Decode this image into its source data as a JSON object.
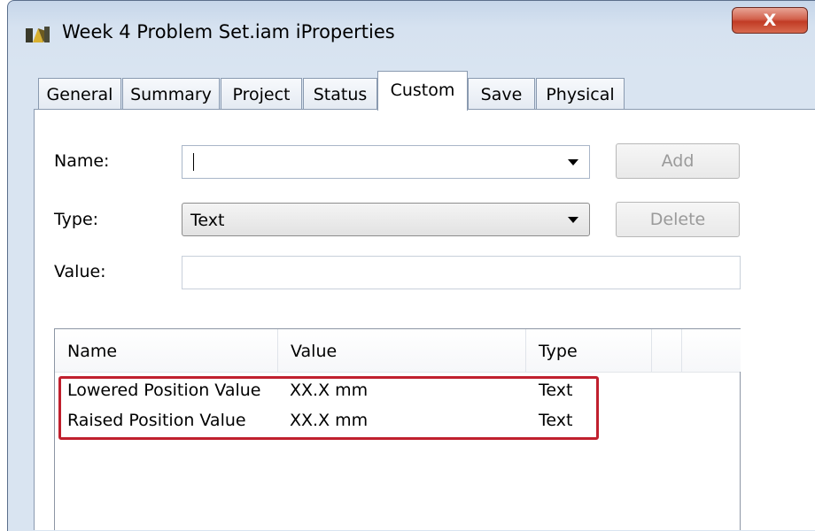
{
  "window": {
    "title": "Week 4 Problem Set.iam iProperties",
    "close_label": "X"
  },
  "tabs": [
    {
      "label": "General"
    },
    {
      "label": "Summary"
    },
    {
      "label": "Project"
    },
    {
      "label": "Status"
    },
    {
      "label": "Custom",
      "active": true
    },
    {
      "label": "Save"
    },
    {
      "label": "Physical"
    }
  ],
  "form": {
    "name_label": "Name:",
    "name_value": "",
    "type_label": "Type:",
    "type_value": "Text",
    "value_label": "Value:",
    "value_value": "",
    "add_label": "Add",
    "delete_label": "Delete"
  },
  "table": {
    "columns": [
      "Name",
      "Value",
      "Type"
    ],
    "rows": [
      {
        "name": "Lowered Position Value",
        "value": "XX.X mm",
        "type": "Text"
      },
      {
        "name": "Raised Position Value",
        "value": "XX.X mm",
        "type": "Text"
      }
    ]
  },
  "colors": {
    "highlight": "#c0202e",
    "close_button": "#c13b25"
  }
}
